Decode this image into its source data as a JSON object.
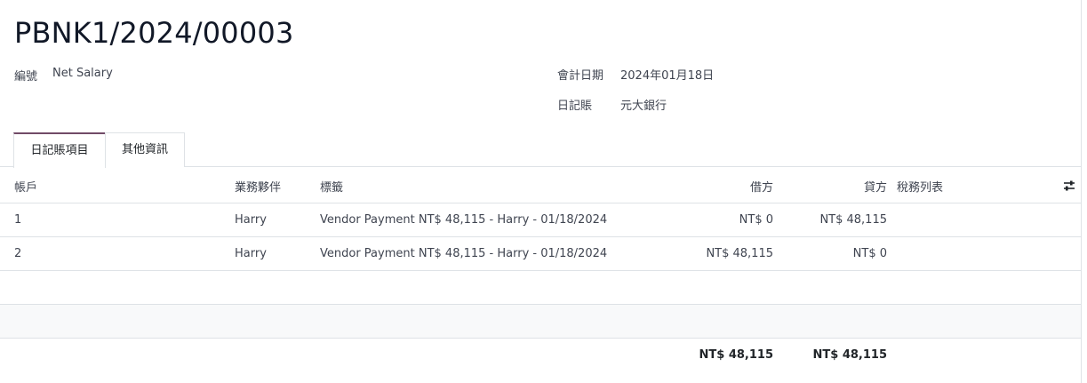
{
  "record": {
    "title": "PBNK1/2024/00003"
  },
  "fields": {
    "ref_label": "編號",
    "ref_value": "Net Salary",
    "date_label": "會計日期",
    "date_value": "2024年01月18日",
    "journal_label": "日記賬",
    "journal_value": "元大銀行"
  },
  "tabs": [
    {
      "label": "日記賬項目",
      "active": true
    },
    {
      "label": "其他資訊",
      "active": false
    }
  ],
  "table": {
    "headers": {
      "account": "帳戶",
      "partner": "業務夥伴",
      "label": "標籤",
      "debit": "借方",
      "credit": "貸方",
      "taxes": "稅務列表"
    },
    "rows": [
      {
        "account": "1",
        "partner": "Harry",
        "label": "Vendor Payment NT$ 48,115 - Harry - 01/18/2024",
        "debit": "NT$ 0",
        "credit": "NT$ 48,115"
      },
      {
        "account": "2",
        "partner": "Harry",
        "label": "Vendor Payment NT$ 48,115 - Harry - 01/18/2024",
        "debit": "NT$ 48,115",
        "credit": "NT$ 0"
      }
    ],
    "totals": {
      "debit": "NT$ 48,115",
      "credit": "NT$ 48,115"
    }
  },
  "icons": {
    "column_settings": "sliders-icon"
  }
}
